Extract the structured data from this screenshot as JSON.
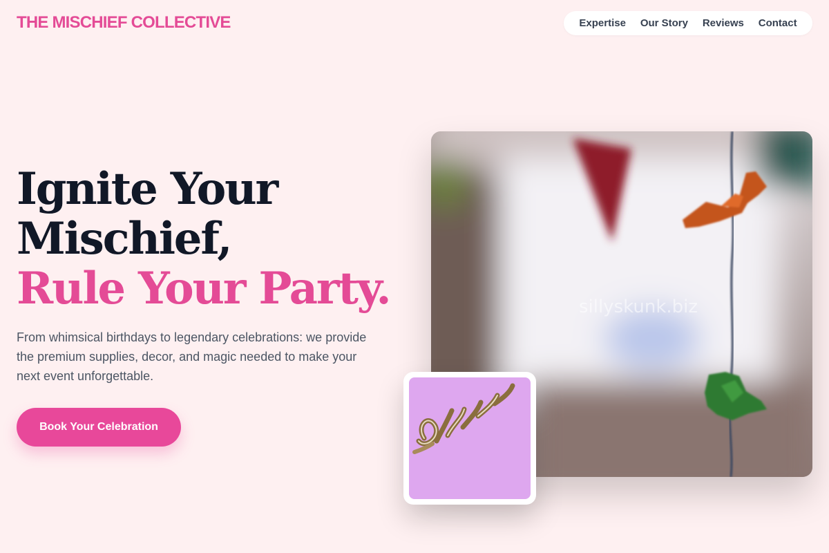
{
  "brand": {
    "name": "THE MISCHIEF COLLECTIVE"
  },
  "nav": {
    "items": [
      {
        "label": "Expertise"
      },
      {
        "label": "Our Story"
      },
      {
        "label": "Reviews"
      },
      {
        "label": "Contact"
      }
    ]
  },
  "hero": {
    "headline_line1": "Ignite Your",
    "headline_line2": "Mischief,",
    "headline_accent": "Rule Your Party.",
    "description": "From whimsical birthdays to legendary celebrations: we provide the premium supplies, decor, and magic needed to make your next event unforgettable.",
    "cta_label": "Book Your Celebration",
    "image_watermark": "sillyskunk.biz"
  },
  "colors": {
    "background": "#fef0f1",
    "accent": "#e44b96",
    "text_dark": "#111827",
    "text_muted": "#4b5563"
  }
}
